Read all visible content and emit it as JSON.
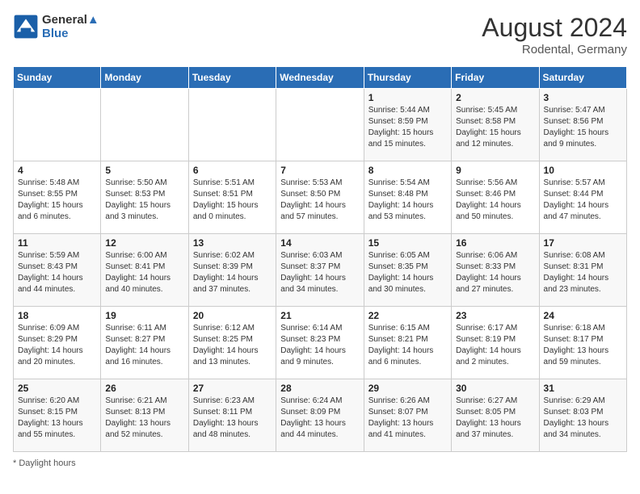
{
  "header": {
    "logo_line1": "General",
    "logo_line2": "Blue",
    "month_year": "August 2024",
    "location": "Rodental, Germany"
  },
  "days_of_week": [
    "Sunday",
    "Monday",
    "Tuesday",
    "Wednesday",
    "Thursday",
    "Friday",
    "Saturday"
  ],
  "weeks": [
    [
      {
        "day": "",
        "info": ""
      },
      {
        "day": "",
        "info": ""
      },
      {
        "day": "",
        "info": ""
      },
      {
        "day": "",
        "info": ""
      },
      {
        "day": "1",
        "info": "Sunrise: 5:44 AM\nSunset: 8:59 PM\nDaylight: 15 hours\nand 15 minutes."
      },
      {
        "day": "2",
        "info": "Sunrise: 5:45 AM\nSunset: 8:58 PM\nDaylight: 15 hours\nand 12 minutes."
      },
      {
        "day": "3",
        "info": "Sunrise: 5:47 AM\nSunset: 8:56 PM\nDaylight: 15 hours\nand 9 minutes."
      }
    ],
    [
      {
        "day": "4",
        "info": "Sunrise: 5:48 AM\nSunset: 8:55 PM\nDaylight: 15 hours\nand 6 minutes."
      },
      {
        "day": "5",
        "info": "Sunrise: 5:50 AM\nSunset: 8:53 PM\nDaylight: 15 hours\nand 3 minutes."
      },
      {
        "day": "6",
        "info": "Sunrise: 5:51 AM\nSunset: 8:51 PM\nDaylight: 15 hours\nand 0 minutes."
      },
      {
        "day": "7",
        "info": "Sunrise: 5:53 AM\nSunset: 8:50 PM\nDaylight: 14 hours\nand 57 minutes."
      },
      {
        "day": "8",
        "info": "Sunrise: 5:54 AM\nSunset: 8:48 PM\nDaylight: 14 hours\nand 53 minutes."
      },
      {
        "day": "9",
        "info": "Sunrise: 5:56 AM\nSunset: 8:46 PM\nDaylight: 14 hours\nand 50 minutes."
      },
      {
        "day": "10",
        "info": "Sunrise: 5:57 AM\nSunset: 8:44 PM\nDaylight: 14 hours\nand 47 minutes."
      }
    ],
    [
      {
        "day": "11",
        "info": "Sunrise: 5:59 AM\nSunset: 8:43 PM\nDaylight: 14 hours\nand 44 minutes."
      },
      {
        "day": "12",
        "info": "Sunrise: 6:00 AM\nSunset: 8:41 PM\nDaylight: 14 hours\nand 40 minutes."
      },
      {
        "day": "13",
        "info": "Sunrise: 6:02 AM\nSunset: 8:39 PM\nDaylight: 14 hours\nand 37 minutes."
      },
      {
        "day": "14",
        "info": "Sunrise: 6:03 AM\nSunset: 8:37 PM\nDaylight: 14 hours\nand 34 minutes."
      },
      {
        "day": "15",
        "info": "Sunrise: 6:05 AM\nSunset: 8:35 PM\nDaylight: 14 hours\nand 30 minutes."
      },
      {
        "day": "16",
        "info": "Sunrise: 6:06 AM\nSunset: 8:33 PM\nDaylight: 14 hours\nand 27 minutes."
      },
      {
        "day": "17",
        "info": "Sunrise: 6:08 AM\nSunset: 8:31 PM\nDaylight: 14 hours\nand 23 minutes."
      }
    ],
    [
      {
        "day": "18",
        "info": "Sunrise: 6:09 AM\nSunset: 8:29 PM\nDaylight: 14 hours\nand 20 minutes."
      },
      {
        "day": "19",
        "info": "Sunrise: 6:11 AM\nSunset: 8:27 PM\nDaylight: 14 hours\nand 16 minutes."
      },
      {
        "day": "20",
        "info": "Sunrise: 6:12 AM\nSunset: 8:25 PM\nDaylight: 14 hours\nand 13 minutes."
      },
      {
        "day": "21",
        "info": "Sunrise: 6:14 AM\nSunset: 8:23 PM\nDaylight: 14 hours\nand 9 minutes."
      },
      {
        "day": "22",
        "info": "Sunrise: 6:15 AM\nSunset: 8:21 PM\nDaylight: 14 hours\nand 6 minutes."
      },
      {
        "day": "23",
        "info": "Sunrise: 6:17 AM\nSunset: 8:19 PM\nDaylight: 14 hours\nand 2 minutes."
      },
      {
        "day": "24",
        "info": "Sunrise: 6:18 AM\nSunset: 8:17 PM\nDaylight: 13 hours\nand 59 minutes."
      }
    ],
    [
      {
        "day": "25",
        "info": "Sunrise: 6:20 AM\nSunset: 8:15 PM\nDaylight: 13 hours\nand 55 minutes."
      },
      {
        "day": "26",
        "info": "Sunrise: 6:21 AM\nSunset: 8:13 PM\nDaylight: 13 hours\nand 52 minutes."
      },
      {
        "day": "27",
        "info": "Sunrise: 6:23 AM\nSunset: 8:11 PM\nDaylight: 13 hours\nand 48 minutes."
      },
      {
        "day": "28",
        "info": "Sunrise: 6:24 AM\nSunset: 8:09 PM\nDaylight: 13 hours\nand 44 minutes."
      },
      {
        "day": "29",
        "info": "Sunrise: 6:26 AM\nSunset: 8:07 PM\nDaylight: 13 hours\nand 41 minutes."
      },
      {
        "day": "30",
        "info": "Sunrise: 6:27 AM\nSunset: 8:05 PM\nDaylight: 13 hours\nand 37 minutes."
      },
      {
        "day": "31",
        "info": "Sunrise: 6:29 AM\nSunset: 8:03 PM\nDaylight: 13 hours\nand 34 minutes."
      }
    ]
  ],
  "footer": {
    "note": "Daylight hours"
  }
}
